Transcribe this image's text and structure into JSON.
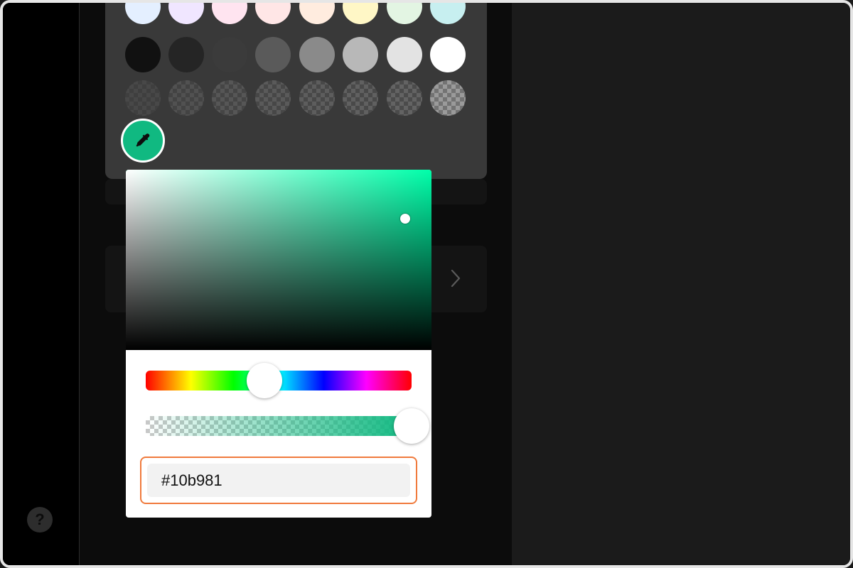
{
  "accent_color": "#10b981",
  "highlight_color": "#f07a3c",
  "help": {
    "label": "?"
  },
  "swatches": {
    "pastel_row": [
      "#e4efff",
      "#f0e6ff",
      "#ffe4f0",
      "#ffe6e6",
      "#ffecdf",
      "#fff7c6",
      "#e3f5e3",
      "#c7eff0"
    ],
    "gray_row": [
      "#111111",
      "#252525",
      "#3b3b3b",
      "#5a5a5a",
      "#8a8a8a",
      "#b8b8b8",
      "#e3e3e3",
      "#ffffff"
    ],
    "transparent_row_count_label": ""
  },
  "color_picker": {
    "hue_name": "green",
    "hex_value": "#10b981",
    "hue_level": 0.44,
    "alpha_level": 1.0
  },
  "icons": {
    "eyedropper": "eyedropper-icon",
    "chevron": "chevron-right-icon",
    "help": "help-icon"
  }
}
